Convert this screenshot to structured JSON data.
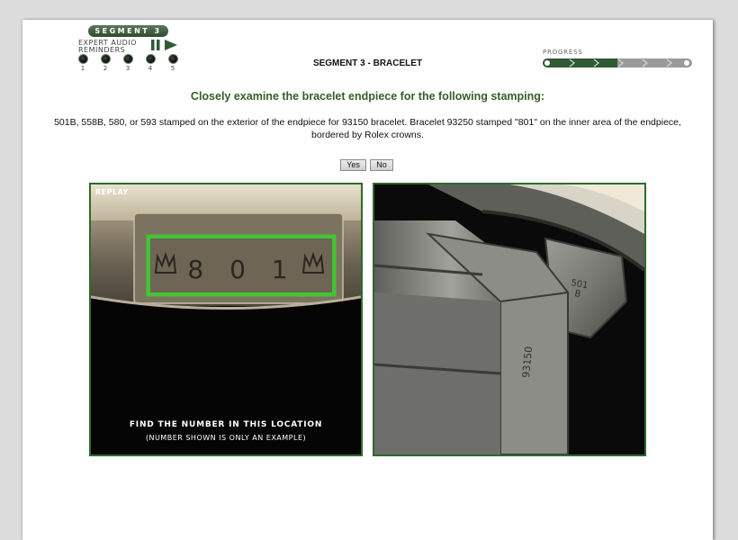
{
  "header": {
    "segment_pill": "SEGMENT 3",
    "audio_label_line1": "EXPERT AUDIO",
    "audio_label_line2": "REMINDERS",
    "audio_tracks": [
      "1",
      "2",
      "3",
      "4",
      "5"
    ],
    "segment_title": "SEGMENT 3 - BRACELET",
    "progress_label": "PROGRESS",
    "progress_fraction": 0.5
  },
  "content": {
    "instruction": "Closely examine the bracelet endpiece for the following stamping:",
    "description": "501B, 558B, 580, or 593 stamped on the exterior of the endpiece for 93150 bracelet. Bracelet 93250 stamped \"801\" on the inner area of the endpiece, bordered by Rolex crowns.",
    "yes_label": "Yes",
    "no_label": "No"
  },
  "left_image": {
    "replay_label": "REPLAY",
    "stamp_text": "8 0 1",
    "caption_line1": "FIND THE NUMBER IN THIS LOCATION",
    "caption_line2": "(NUMBER SHOWN IS ONLY AN EXAMPLE)"
  },
  "right_image": {
    "stamp_top": "501",
    "stamp_top2": "B",
    "stamp_side": "93150"
  },
  "colors": {
    "accent_green": "#355e2a",
    "frame_green": "#2d6a2d",
    "progress_fill": "#2f5a35"
  }
}
